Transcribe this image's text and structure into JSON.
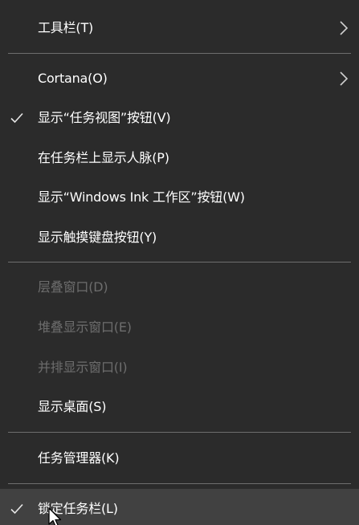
{
  "menu": {
    "items": [
      {
        "label": "工具栏(T)",
        "checked": false,
        "submenu": true,
        "enabled": true
      },
      {
        "label": "Cortana(O)",
        "checked": false,
        "submenu": true,
        "enabled": true
      },
      {
        "label": "显示“任务视图”按钮(V)",
        "checked": true,
        "submenu": false,
        "enabled": true
      },
      {
        "label": "在任务栏上显示人脉(P)",
        "checked": false,
        "submenu": false,
        "enabled": true
      },
      {
        "label": "显示“Windows Ink 工作区”按钮(W)",
        "checked": false,
        "submenu": false,
        "enabled": true
      },
      {
        "label": "显示触摸键盘按钮(Y)",
        "checked": false,
        "submenu": false,
        "enabled": true
      },
      {
        "label": "层叠窗口(D)",
        "checked": false,
        "submenu": false,
        "enabled": false
      },
      {
        "label": "堆叠显示窗口(E)",
        "checked": false,
        "submenu": false,
        "enabled": false
      },
      {
        "label": "并排显示窗口(I)",
        "checked": false,
        "submenu": false,
        "enabled": false
      },
      {
        "label": "显示桌面(S)",
        "checked": false,
        "submenu": false,
        "enabled": true
      },
      {
        "label": "任务管理器(K)",
        "checked": false,
        "submenu": false,
        "enabled": true
      },
      {
        "label": "锁定任务栏(L)",
        "checked": true,
        "submenu": false,
        "enabled": true,
        "hovered": true
      }
    ]
  },
  "icons": {
    "check": "check-icon",
    "submenu": "chevron-right-icon",
    "cursor": "mouse-pointer-icon"
  },
  "colors": {
    "menu_background": "#2b2b2b",
    "hover_background": "#414141",
    "separator": "#6e6e6e",
    "text": "#ffffff",
    "disabled_text": "#6d6d6d"
  }
}
